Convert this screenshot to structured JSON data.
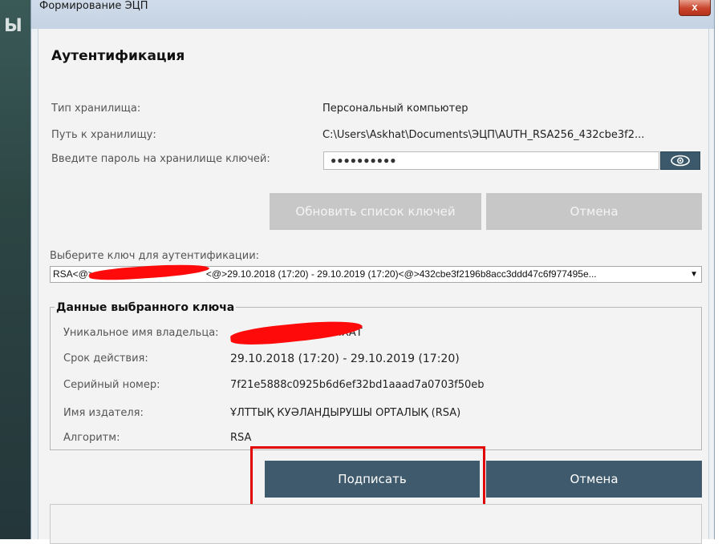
{
  "background": {
    "partial_text": "Ы"
  },
  "window": {
    "title": "Формирование ЭЦП",
    "close_label": "x"
  },
  "heading": "Аутентификация",
  "fields": {
    "storage_type_label": "Тип хранилища:",
    "storage_type_value": "Персональный компьютер",
    "storage_path_label": "Путь к хранилищу:",
    "storage_path_value": "C:\\Users\\Askhat\\Documents\\ЭЦП\\AUTH_RSA256_432cbe3f2...",
    "password_label": "Введите пароль на хранилище ключей:",
    "password_value": "●●●●●●●●●●",
    "eye_icon": "eye-icon"
  },
  "buttons": {
    "refresh_keys": "Обновить список ключей",
    "cancel_top": "Отмена",
    "sign": "Подписать",
    "cancel_bottom": "Отмена"
  },
  "key_select": {
    "label": "Выберите ключ для аутентификации:",
    "prefix": "RSA<@>",
    "suffix": "<@>29.10.2018 (17:20) - 29.10.2019 (17:20)<@>432cbe3f2196b8acc3ddd47c6f977495e...",
    "arrow": "▼"
  },
  "key_data": {
    "group_title": "Данные выбранного ключа",
    "owner_label": "Уникальное имя владельца:",
    "owner_visible_tail": "…ХАТ",
    "validity_label": "Срок действия:",
    "validity_value": "29.10.2018 (17:20) - 29.10.2019 (17:20)",
    "serial_label": "Серийный номер:",
    "serial_value": "7f21e5888c0925b6d6ef32bd1aaad7a0703f50eb",
    "issuer_label": "Имя издателя:",
    "issuer_value": "ҰЛТТЫҚ КУӘЛАНДЫРУШЫ ОРТАЛЫҚ (RSA)",
    "algorithm_label": "Алгоритм:",
    "algorithm_value": "RSA"
  },
  "colors": {
    "primary_button": "#3f5a6c",
    "disabled_button": "#c7c7c7",
    "highlight": "#e00000",
    "redaction": "#ff0a0a"
  }
}
